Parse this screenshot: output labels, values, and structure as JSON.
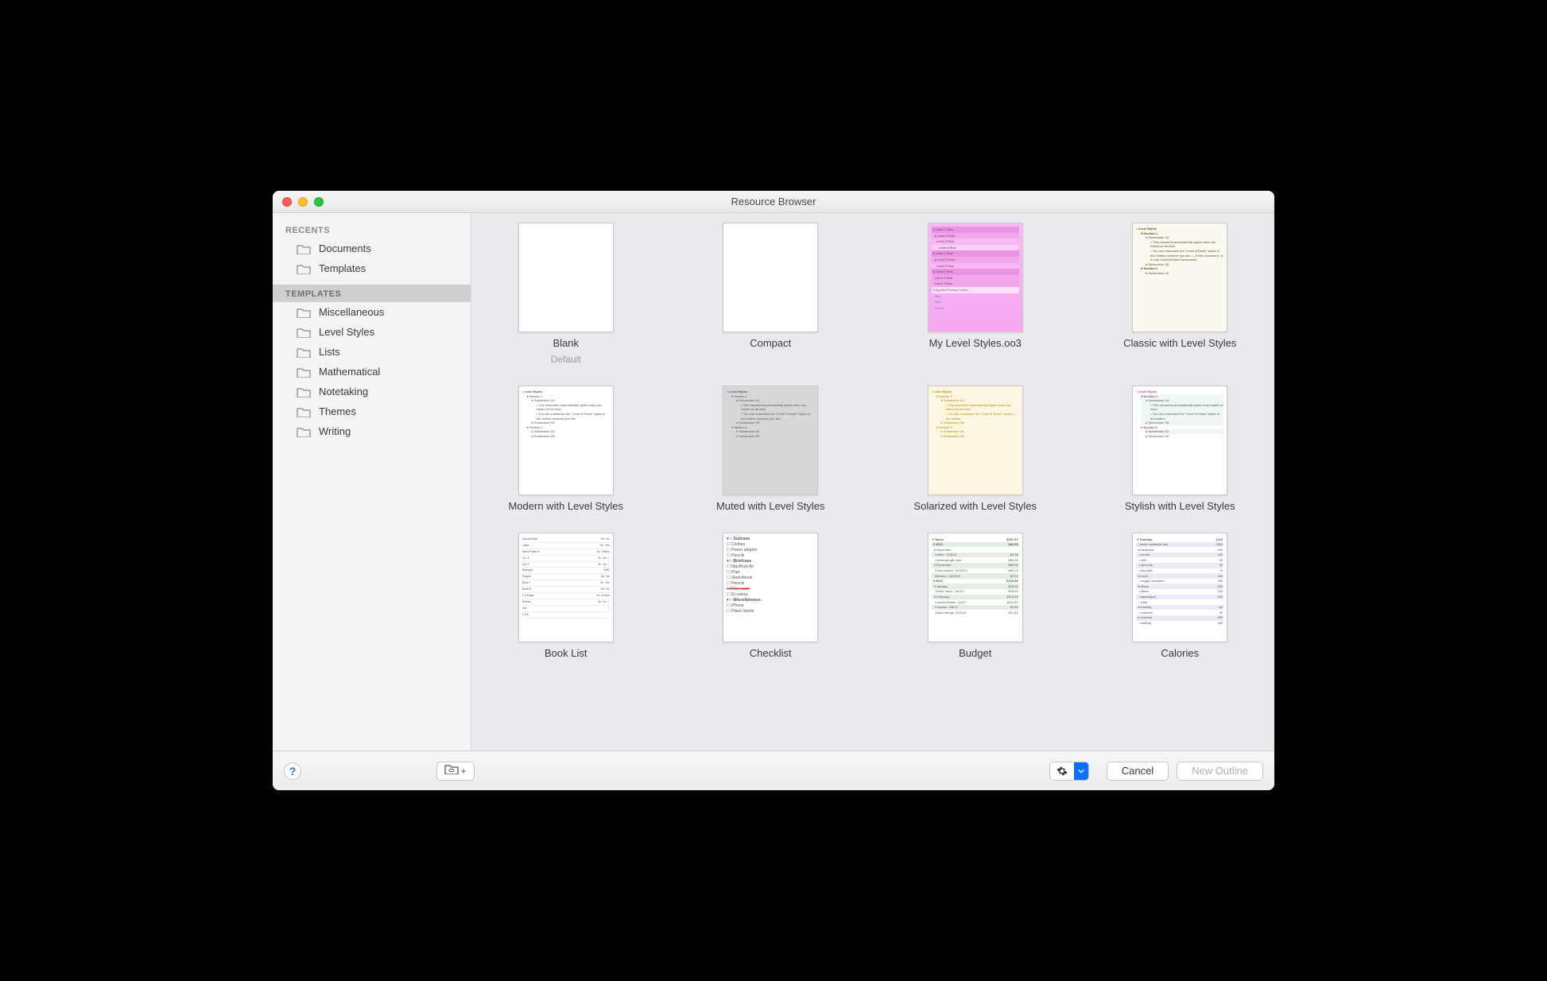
{
  "window": {
    "title": "Resource Browser"
  },
  "sidebar": {
    "sections": [
      {
        "header": "RECENTS",
        "selected": false,
        "items": [
          {
            "label": "Documents"
          },
          {
            "label": "Templates"
          }
        ]
      },
      {
        "header": "TEMPLATES",
        "selected": true,
        "items": [
          {
            "label": "Miscellaneous"
          },
          {
            "label": "Level Styles"
          },
          {
            "label": "Lists"
          },
          {
            "label": "Mathematical"
          },
          {
            "label": "Notetaking"
          },
          {
            "label": "Themes"
          },
          {
            "label": "Writing"
          }
        ]
      }
    ]
  },
  "templates": [
    {
      "label": "Blank",
      "sub": "Default",
      "kind": "blank"
    },
    {
      "label": "Compact",
      "kind": "blank"
    },
    {
      "label": "My Level Styles.oo3",
      "kind": "pink"
    },
    {
      "label": "Classic with Level Styles",
      "kind": "classic"
    },
    {
      "label": "Modern with Level Styles",
      "kind": "modern"
    },
    {
      "label": "Muted with Level Styles",
      "kind": "muted"
    },
    {
      "label": "Solarized with Level Styles",
      "kind": "solar"
    },
    {
      "label": "Stylish with Level Styles",
      "kind": "stylish"
    },
    {
      "label": "Book List",
      "kind": "booklist"
    },
    {
      "label": "Checklist",
      "kind": "checklist"
    },
    {
      "label": "Budget",
      "kind": "budget"
    },
    {
      "label": "Calories",
      "kind": "calories"
    }
  ],
  "toolbar": {
    "help_label": "?",
    "cancel_label": "Cancel",
    "new_label": "New Outline"
  }
}
